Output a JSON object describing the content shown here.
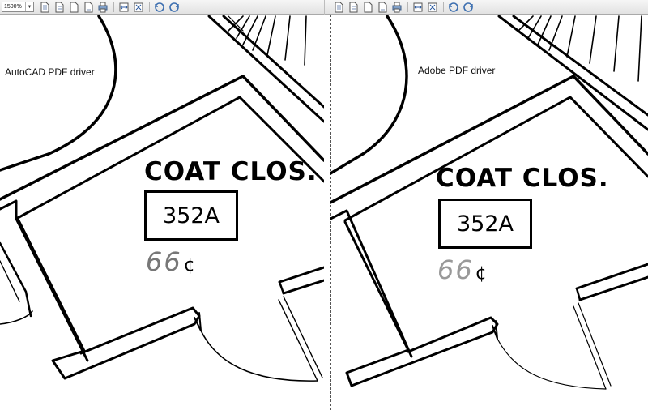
{
  "toolbar": {
    "zoom_value": "1500%",
    "dropdown_icon": "dropdown-arrow-icon",
    "buttons": [
      "page-icon",
      "page-icon",
      "page-icon",
      "page-icon",
      "printer-icon",
      "fit-width-icon",
      "fit-page-icon",
      "rotate-left-icon",
      "rotate-right-icon"
    ]
  },
  "panes": [
    {
      "label": "AutoCAD PDF driver",
      "room_name": "COAT CLOS.",
      "room_number": "352A",
      "area_value": "66",
      "area_unit": "¢"
    },
    {
      "label": "Adobe PDF driver",
      "room_name": "COAT CLOS.",
      "room_number": "352A",
      "area_value": "66",
      "area_unit": "¢"
    }
  ],
  "colors": {
    "linework": "#000000",
    "area_text_left": "#777777",
    "area_text_right": "#999999"
  }
}
